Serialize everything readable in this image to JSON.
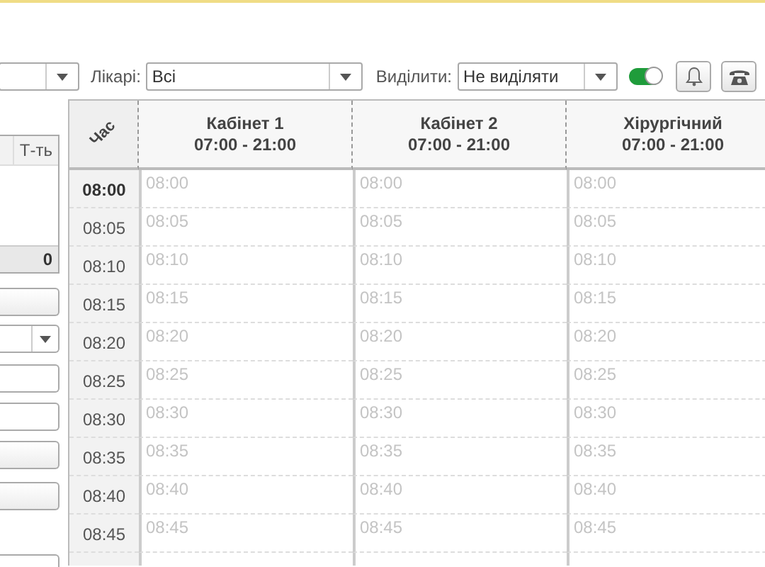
{
  "toolbar": {
    "doctors": {
      "label": "Лікарі:",
      "value": "Всі"
    },
    "highlight": {
      "label": "Виділити:",
      "value": "Не виділяти"
    },
    "toggle": {
      "on": true
    }
  },
  "left_panel": {
    "table": {
      "column": "Т-ть",
      "total": "0"
    },
    "controls": [
      {
        "kind": "button"
      },
      {
        "kind": "dropdown"
      },
      {
        "kind": "field"
      },
      {
        "kind": "field"
      },
      {
        "kind": "button"
      },
      {
        "kind": "button"
      },
      {
        "kind": "field"
      }
    ]
  },
  "schedule": {
    "time_header": "Час",
    "columns": [
      {
        "name": "Кабінет 1",
        "hours": "07:00 - 21:00"
      },
      {
        "name": "Кабінет 2",
        "hours": "07:00 - 21:00"
      },
      {
        "name": "Хірургічний",
        "hours": "07:00 - 21:00"
      }
    ],
    "rows": [
      {
        "time": "08:00",
        "current": true,
        "slots": [
          "08:00",
          "08:00",
          "08:00"
        ]
      },
      {
        "time": "08:05",
        "current": false,
        "slots": [
          "08:05",
          "08:05",
          "08:05"
        ]
      },
      {
        "time": "08:10",
        "current": false,
        "slots": [
          "08:10",
          "08:10",
          "08:10"
        ]
      },
      {
        "time": "08:15",
        "current": false,
        "slots": [
          "08:15",
          "08:15",
          "08:15"
        ]
      },
      {
        "time": "08:20",
        "current": false,
        "slots": [
          "08:20",
          "08:20",
          "08:20"
        ]
      },
      {
        "time": "08:25",
        "current": false,
        "slots": [
          "08:25",
          "08:25",
          "08:25"
        ]
      },
      {
        "time": "08:30",
        "current": false,
        "slots": [
          "08:30",
          "08:30",
          "08:30"
        ]
      },
      {
        "time": "08:35",
        "current": false,
        "slots": [
          "08:35",
          "08:35",
          "08:35"
        ]
      },
      {
        "time": "08:40",
        "current": false,
        "slots": [
          "08:40",
          "08:40",
          "08:40"
        ]
      },
      {
        "time": "08:45",
        "current": false,
        "slots": [
          "08:45",
          "08:45",
          "08:45"
        ]
      }
    ]
  }
}
